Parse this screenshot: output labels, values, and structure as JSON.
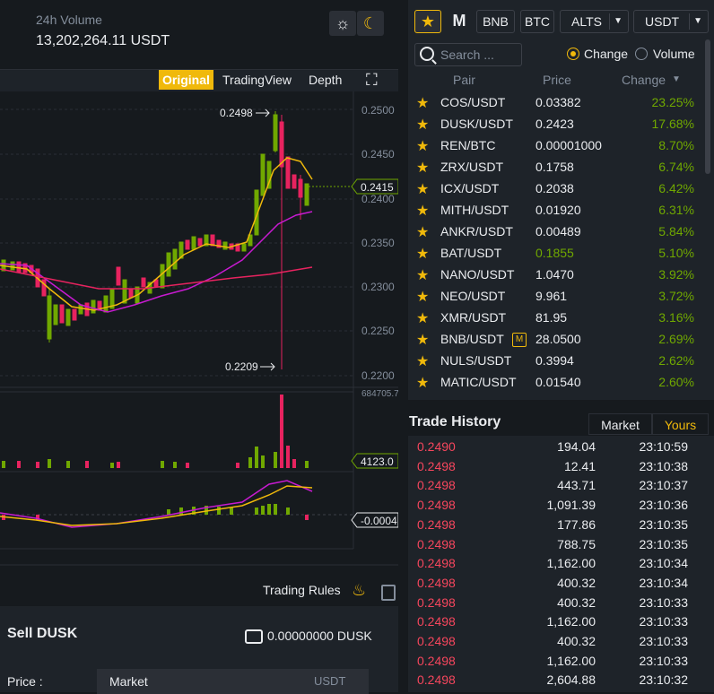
{
  "header": {
    "volume_label": "24h Volume",
    "volume_value": "13,202,264.11 USDT"
  },
  "chart_toolbar": {
    "original": "Original",
    "tradingview": "TradingView",
    "depth": "Depth"
  },
  "chart": {
    "price_axis": [
      "0.2500",
      "0.2450",
      "0.2400",
      "0.2350",
      "0.2300",
      "0.2250",
      "0.2200"
    ],
    "current_price_tag": "0.2415",
    "high_label": "0.2498",
    "low_label": "0.2209",
    "volume_axis_top": "684705.70",
    "volume_tag": "4123.0",
    "macd_tag": "-0.0004"
  },
  "bottom_left": {
    "trading_rules": "Trading Rules",
    "sell_title": "Sell DUSK",
    "balance": "0.00000000 DUSK",
    "price_label": "Price :",
    "price_mode": "Market",
    "price_unit": "USDT"
  },
  "market_panel": {
    "star": "★",
    "m_tab": "M",
    "tabs": [
      "BNB",
      "BTC",
      "ALTS",
      "USDT"
    ],
    "search_placeholder": "Search ...",
    "radio_change": "Change",
    "radio_volume": "Volume",
    "col_pair": "Pair",
    "col_price": "Price",
    "col_change": "Change",
    "badge": "M",
    "rows": [
      {
        "pair": "COS/USDT",
        "price": "0.03382",
        "change": "23.25%"
      },
      {
        "pair": "DUSK/USDT",
        "price": "0.2423",
        "change": "17.68%"
      },
      {
        "pair": "REN/BTC",
        "price": "0.00001000",
        "change": "8.70%"
      },
      {
        "pair": "ZRX/USDT",
        "price": "0.1758",
        "change": "6.74%"
      },
      {
        "pair": "ICX/USDT",
        "price": "0.2038",
        "change": "6.42%"
      },
      {
        "pair": "MITH/USDT",
        "price": "0.01920",
        "change": "6.31%"
      },
      {
        "pair": "ANKR/USDT",
        "price": "0.00489",
        "change": "5.84%"
      },
      {
        "pair": "BAT/USDT",
        "price": "0.1855",
        "change": "5.10%"
      },
      {
        "pair": "NANO/USDT",
        "price": "1.0470",
        "change": "3.92%"
      },
      {
        "pair": "NEO/USDT",
        "price": "9.961",
        "change": "3.72%"
      },
      {
        "pair": "XMR/USDT",
        "price": "81.95",
        "change": "3.16%"
      },
      {
        "pair": "BNB/USDT",
        "price": "28.0500",
        "change": "2.69%"
      },
      {
        "pair": "NULS/USDT",
        "price": "0.3994",
        "change": "2.62%"
      },
      {
        "pair": "MATIC/USDT",
        "price": "0.01540",
        "change": "2.60%"
      }
    ]
  },
  "trade_history": {
    "title": "Trade History",
    "tab_market": "Market",
    "tab_yours": "Yours",
    "rows": [
      {
        "price": "0.2490",
        "amount": "194.04",
        "time": "23:10:59"
      },
      {
        "price": "0.2498",
        "amount": "12.41",
        "time": "23:10:38"
      },
      {
        "price": "0.2498",
        "amount": "443.71",
        "time": "23:10:37"
      },
      {
        "price": "0.2498",
        "amount": "1,091.39",
        "time": "23:10:36"
      },
      {
        "price": "0.2498",
        "amount": "177.86",
        "time": "23:10:35"
      },
      {
        "price": "0.2498",
        "amount": "788.75",
        "time": "23:10:35"
      },
      {
        "price": "0.2498",
        "amount": "1,162.00",
        "time": "23:10:34"
      },
      {
        "price": "0.2498",
        "amount": "400.32",
        "time": "23:10:34"
      },
      {
        "price": "0.2498",
        "amount": "400.32",
        "time": "23:10:33"
      },
      {
        "price": "0.2498",
        "amount": "1,162.00",
        "time": "23:10:33"
      },
      {
        "price": "0.2498",
        "amount": "400.32",
        "time": "23:10:33"
      },
      {
        "price": "0.2498",
        "amount": "1,162.00",
        "time": "23:10:33"
      },
      {
        "price": "0.2498",
        "amount": "2,604.88",
        "time": "23:10:32"
      }
    ]
  },
  "colors": {
    "accent": "#f0b90b",
    "up": "#70a800",
    "down": "#f6465d",
    "background": "#161a1e",
    "panel": "#1e2329"
  }
}
